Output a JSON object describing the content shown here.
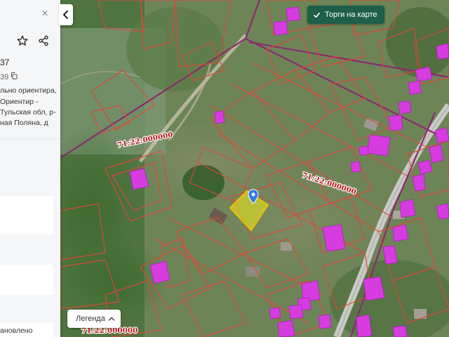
{
  "panel": {
    "close_symbol": "×",
    "id_fragment": "37",
    "number_fragment": "39",
    "address_lines": [
      "льно ориентира,",
      "Ориентир -",
      "Тульская обл, р-",
      "ная Поляна, д"
    ],
    "bottom_text": "ановлено",
    "icons": [
      "close-icon",
      "star-icon",
      "share-icon",
      "copy-icon"
    ]
  },
  "toggle": {
    "icon": "chevron-left-icon"
  },
  "torgi_button": {
    "label": "Торги на карте",
    "icon": "check-icon",
    "color": "#1d5f4a"
  },
  "legend_button": {
    "label": "Легенда",
    "icon": "chevron-up-icon"
  },
  "map": {
    "quarter_labels": [
      "71:22:000000",
      "71:22:000000",
      "71:22:000000"
    ],
    "colors": {
      "parcel_border": "#e0473a",
      "selected_fill": "#f4ee1a",
      "selected_border": "#e8c300",
      "buildings": "#d63ce0",
      "quarter_line": "#8a2b6e",
      "marker": "#2f7fe0"
    }
  }
}
